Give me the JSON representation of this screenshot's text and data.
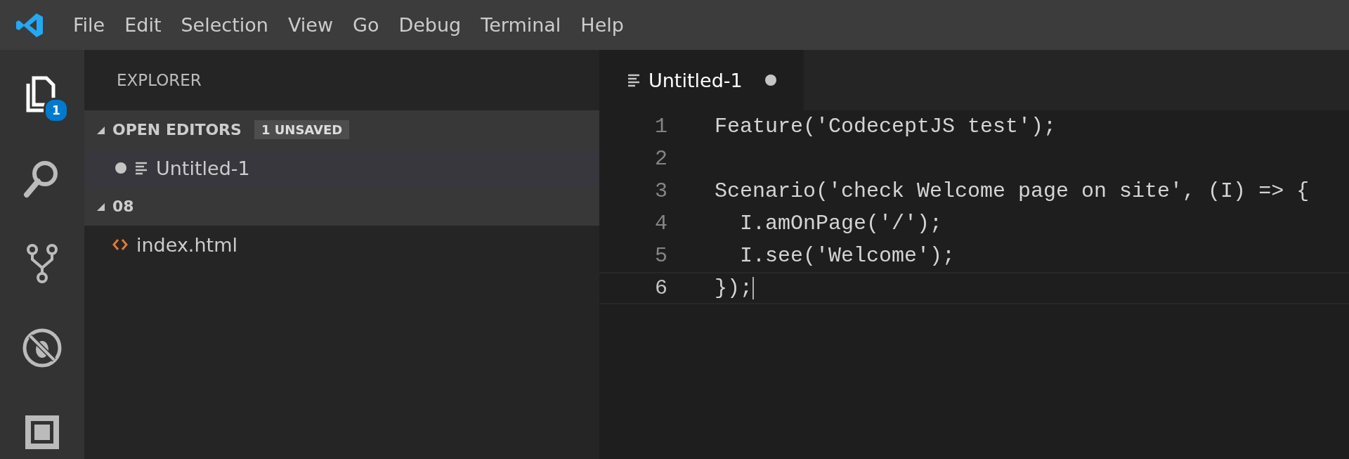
{
  "menu": [
    "File",
    "Edit",
    "Selection",
    "View",
    "Go",
    "Debug",
    "Terminal",
    "Help"
  ],
  "activity_bar": [
    {
      "kind": "files",
      "selected": true,
      "badge": "1"
    },
    {
      "kind": "search",
      "selected": false
    },
    {
      "kind": "source-control",
      "selected": false
    },
    {
      "kind": "debug",
      "selected": false
    },
    {
      "kind": "extensions",
      "selected": false
    }
  ],
  "sidebar": {
    "title": "EXPLORER",
    "sections": [
      {
        "title": "OPEN EDITORS",
        "expanded": true,
        "badge": "1 UNSAVED",
        "items": [
          {
            "name": "Untitled-1",
            "kind": "text",
            "dirty": true,
            "selected": true
          }
        ]
      },
      {
        "title": "08",
        "expanded": true,
        "items": [
          {
            "name": "index.html",
            "kind": "html",
            "selected": false
          }
        ]
      }
    ]
  },
  "tabs": [
    {
      "label": "Untitled-1",
      "selected": true,
      "dirty": true
    }
  ],
  "editor": {
    "lines": [
      {
        "number": "1",
        "text": "Feature('CodeceptJS test');",
        "current": false
      },
      {
        "number": "2",
        "current": false
      },
      {
        "number": "3",
        "text": "Scenario('check Welcome page on site', (I) => {",
        "current": false
      },
      {
        "number": "4",
        "text": "  I.amOnPage('/');",
        "current": false
      },
      {
        "number": "5",
        "text": "  I.see('Welcome');",
        "current": false
      },
      {
        "number": "6",
        "text": "});",
        "current": true
      }
    ]
  }
}
